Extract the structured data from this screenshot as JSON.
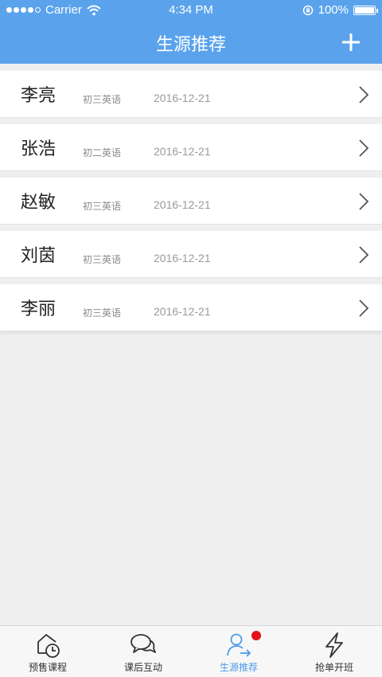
{
  "status_bar": {
    "carrier": "Carrier",
    "time": "4:34 PM",
    "battery": "100%"
  },
  "nav": {
    "title": "生源推荐"
  },
  "students": [
    {
      "name": "李亮",
      "grade": "初三英语",
      "date": "2016-12-21"
    },
    {
      "name": "张浩",
      "grade": "初二英语",
      "date": "2016-12-21"
    },
    {
      "name": "赵敏",
      "grade": "初三英语",
      "date": "2016-12-21"
    },
    {
      "name": "刘茵",
      "grade": "初三英语",
      "date": "2016-12-21"
    },
    {
      "name": "李丽",
      "grade": "初三英语",
      "date": "2016-12-21"
    }
  ],
  "tabs": [
    {
      "label": "预售课程",
      "icon": "clock-icon",
      "active": false
    },
    {
      "label": "课后互动",
      "icon": "chat-bubbles-icon",
      "active": false
    },
    {
      "label": "生源推荐",
      "icon": "user-arrow-icon",
      "active": true
    },
    {
      "label": "抢单开班",
      "icon": "lightning-icon",
      "active": false
    }
  ],
  "colors": {
    "header": "#5aa3ec",
    "active_tab": "#4b9be8",
    "badge": "#e0131a"
  }
}
